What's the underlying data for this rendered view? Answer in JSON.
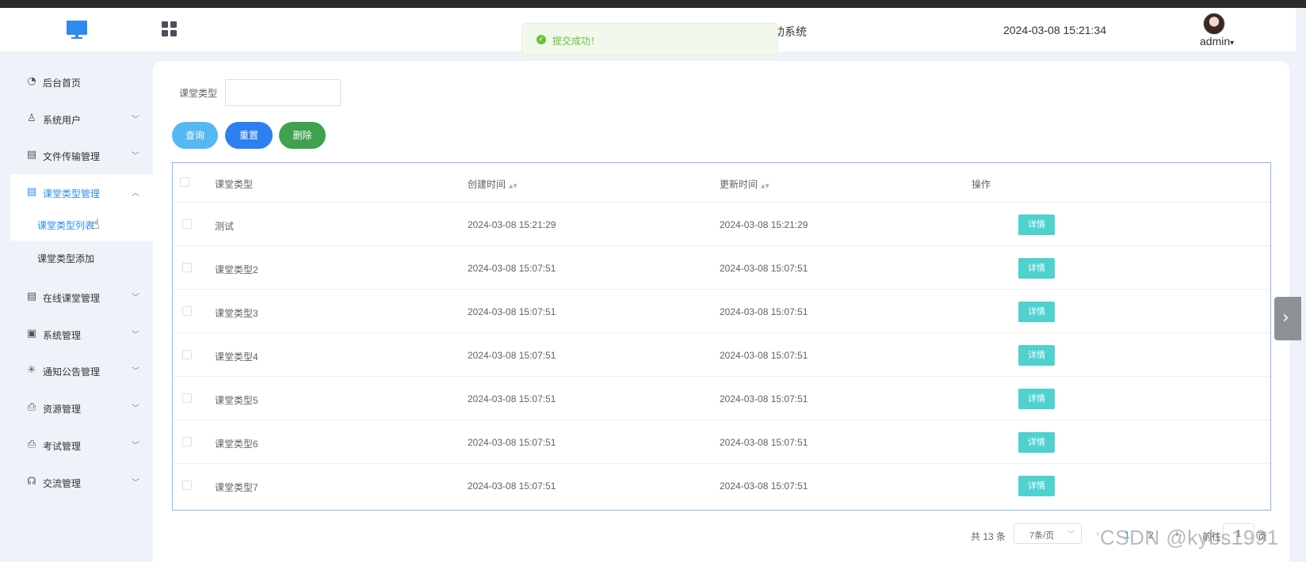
{
  "header": {
    "system_title": "助系统",
    "datetime": "2024-03-08 15:21:34",
    "user": "admin",
    "user_caret": "▾"
  },
  "toast": {
    "icon": "✓",
    "message": "提交成功！",
    "type": "success",
    "color": "#67c23a"
  },
  "sidebar": {
    "items": [
      {
        "label": "后台首页",
        "icon": "dashboard-icon",
        "glyph": "◔",
        "arrow": ""
      },
      {
        "label": "系统用户",
        "icon": "user-icon",
        "glyph": "♙",
        "arrow": "﹀"
      },
      {
        "label": "文件传输管理",
        "icon": "id-card-icon",
        "glyph": "▤",
        "arrow": "﹀"
      },
      {
        "label": "课堂类型管理",
        "icon": "id-card-icon",
        "glyph": "▤",
        "arrow": "︿",
        "active": true
      },
      {
        "label": "在线课堂管理",
        "icon": "id-card-icon",
        "glyph": "▤",
        "arrow": "﹀"
      },
      {
        "label": "系统管理",
        "icon": "folder-check-icon",
        "glyph": "▣",
        "arrow": "﹀"
      },
      {
        "label": "通知公告管理",
        "icon": "sun-icon",
        "glyph": "✳",
        "arrow": "﹀"
      },
      {
        "label": "资源管理",
        "icon": "printer-icon",
        "glyph": "⎙",
        "arrow": "﹀"
      },
      {
        "label": "考试管理",
        "icon": "printer-icon",
        "glyph": "⎙",
        "arrow": "﹀"
      },
      {
        "label": "交流管理",
        "icon": "headset-icon",
        "glyph": "☊",
        "arrow": "﹀"
      }
    ],
    "submenu": [
      {
        "label": "课堂类型列表",
        "selected": true
      },
      {
        "label": "课堂类型添加",
        "selected": false
      }
    ],
    "accent": "#2d8cf0"
  },
  "search": {
    "label": "课堂类型",
    "value": "",
    "placeholder": ""
  },
  "buttons": {
    "query": "查询",
    "reset": "重置",
    "delete": "删除",
    "colors": {
      "query": "#55b8f2",
      "reset": "#2e7ff0",
      "delete": "#3fa24e"
    }
  },
  "table": {
    "columns": [
      "课堂类型",
      "创建时间",
      "更新时间",
      "操作"
    ],
    "sort_icon": "▲▼",
    "detail_label": "详情",
    "detail_color": "#4fd1cf",
    "rows": [
      {
        "type": "测试",
        "created": "2024-03-08 15:21:29",
        "updated": "2024-03-08 15:21:29"
      },
      {
        "type": "课堂类型2",
        "created": "2024-03-08 15:07:51",
        "updated": "2024-03-08 15:07:51"
      },
      {
        "type": "课堂类型3",
        "created": "2024-03-08 15:07:51",
        "updated": "2024-03-08 15:07:51"
      },
      {
        "type": "课堂类型4",
        "created": "2024-03-08 15:07:51",
        "updated": "2024-03-08 15:07:51"
      },
      {
        "type": "课堂类型5",
        "created": "2024-03-08 15:07:51",
        "updated": "2024-03-08 15:07:51"
      },
      {
        "type": "课堂类型6",
        "created": "2024-03-08 15:07:51",
        "updated": "2024-03-08 15:07:51"
      },
      {
        "type": "课堂类型7",
        "created": "2024-03-08 15:07:51",
        "updated": "2024-03-08 15:07:51"
      }
    ]
  },
  "pagination": {
    "total": "共 13 条",
    "page_size": "7条/页",
    "size_caret": "﹀",
    "prev": "‹",
    "pages": [
      "1",
      "2"
    ],
    "current_page": "1",
    "next": "›",
    "goto_label": "前往",
    "goto_value": "1",
    "page_suffix": "页"
  },
  "side_tab": {
    "icon": "chevron-right-icon",
    "glyph": "›"
  },
  "watermark": "CSDN @kybs1991"
}
